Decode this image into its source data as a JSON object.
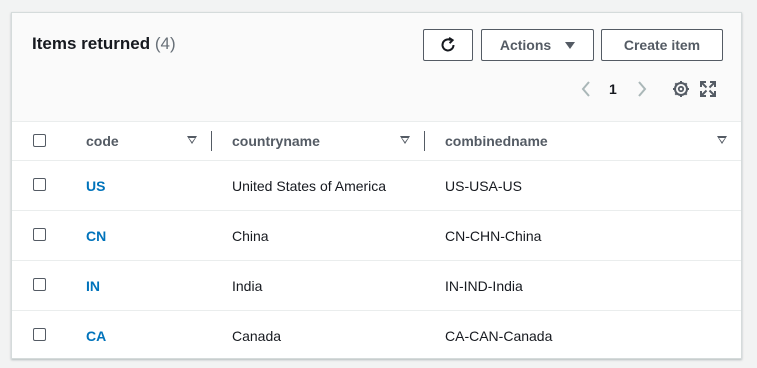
{
  "header": {
    "title": "Items returned",
    "count": "(4)",
    "actions_label": "Actions",
    "create_label": "Create item"
  },
  "pagination": {
    "current_page": "1"
  },
  "table": {
    "columns": [
      "code",
      "countryname",
      "combinedname"
    ],
    "rows": [
      {
        "code": "US",
        "countryname": "United States of America",
        "combinedname": "US-USA-US"
      },
      {
        "code": "CN",
        "countryname": "China",
        "combinedname": "CN-CHN-China"
      },
      {
        "code": "IN",
        "countryname": "India",
        "combinedname": "IN-IND-India"
      },
      {
        "code": "CA",
        "countryname": "Canada",
        "combinedname": "CA-CAN-Canada"
      }
    ]
  },
  "colors": {
    "link": "#0073bb",
    "text": "#16191f",
    "muted": "#687078",
    "border": "#545b64"
  }
}
